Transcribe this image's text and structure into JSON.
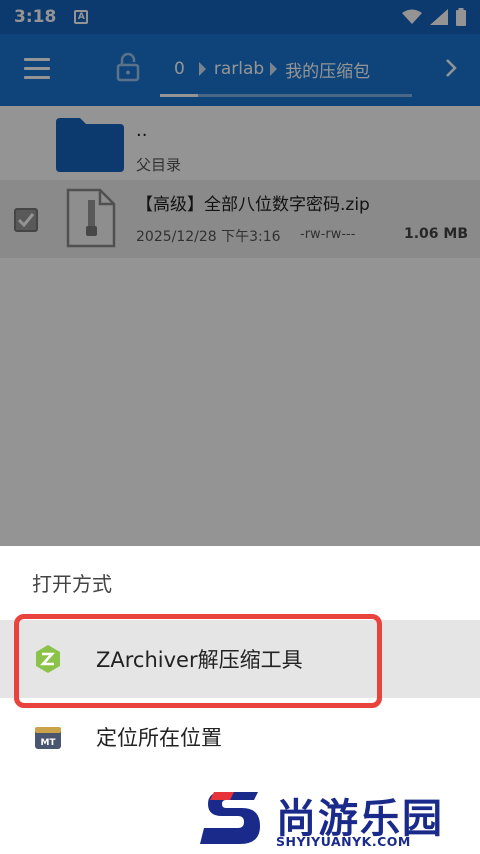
{
  "status_bar": {
    "time": "3:18",
    "notification": "A"
  },
  "toolbar": {
    "breadcrumb": [
      {
        "label": "0"
      },
      {
        "label": "rarlab"
      },
      {
        "label": "我的压缩包"
      }
    ],
    "progress": 0.15
  },
  "files": {
    "parent": {
      "name": "..",
      "subtitle": "父目录"
    },
    "items": [
      {
        "name": "【高级】全部八位数字密码.zip",
        "date": "2025/12/28 下午3:16",
        "permissions": "-rw-rw---",
        "size": "1.06 MB",
        "checked": true
      }
    ]
  },
  "open_with": {
    "title": "打开方式",
    "options": [
      {
        "label": "ZArchiver解压缩工具",
        "icon": "zarchiver-icon"
      },
      {
        "label": "定位所在位置",
        "icon": "mt-manager-icon"
      }
    ],
    "highlight_color": "#e8433d"
  },
  "watermark": {
    "text_cn": "尚游乐园",
    "text_en": "SHYIYUANYK.COM"
  },
  "colors": {
    "statusbar": "#1565c0",
    "toolbar": "#1976d2",
    "folder": "#1565c0"
  }
}
